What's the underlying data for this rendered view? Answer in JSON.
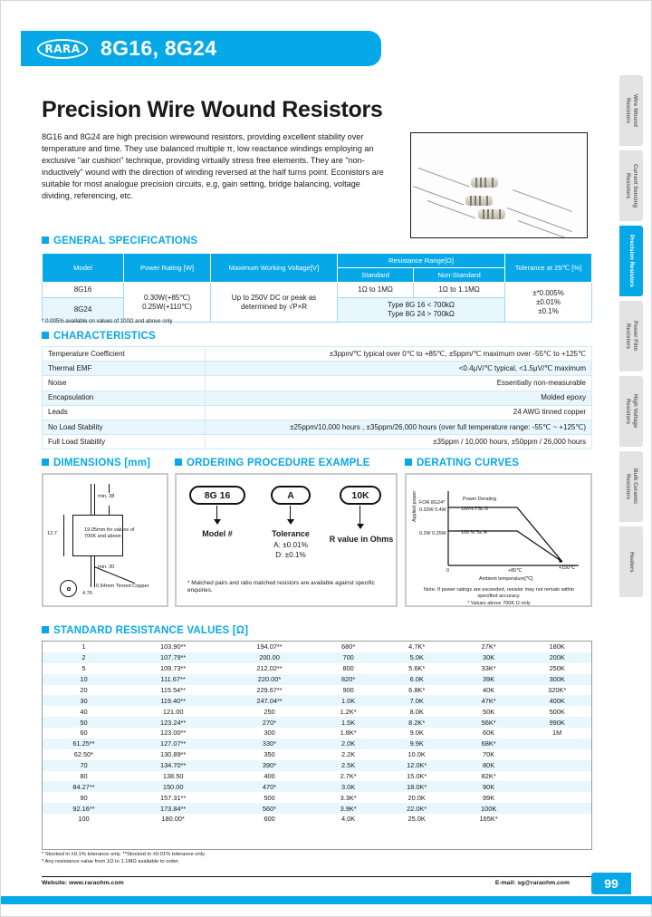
{
  "brand": {
    "logo_text": "RARA",
    "model_title": "8G16, 8G24"
  },
  "hero": {
    "title": "Precision Wire Wound Resistors",
    "body": "8G16 and 8G24 are high precision wirewound resistors, providing excellent stability over temperature and time. They use balanced multiple π, low reactance windings employing an exclusive \"air cushion\" technique, providing virtually stress free elements. They are \"non-inductively\" wound with the direction of winding reversed at the half turns point. Econistors are suitable for most analogue precision circuits, e.g, gain setting, bridge balancing, voltage dividing, referencing, etc."
  },
  "side_tabs": [
    {
      "label": "Wire Wound Resistors",
      "active": false
    },
    {
      "label": "Current Sensing Resistors",
      "active": false
    },
    {
      "label": "Precision Resistors",
      "active": true
    },
    {
      "label": "Power Film Resistors",
      "active": false
    },
    {
      "label": "High Voltage Resistors",
      "active": false
    },
    {
      "label": "Bulk Ceramic Resistors",
      "active": false
    },
    {
      "label": "Heaters",
      "active": false
    }
  ],
  "general_specifications": {
    "heading": "GENERAL SPECIFICATIONS",
    "headers": {
      "model": "Model",
      "power_rating": "Power Rating [W]",
      "max_voltage": "Maximum Working Voltage[V]",
      "resistance_range": "Resistance Range[Ω]",
      "standard": "Standard",
      "non_standard": "Non-Standard",
      "tolerance": "Tolerance at 25℃ [%]"
    },
    "rows": [
      {
        "model": "8G16",
        "standard": "1Ω to 1MΩ",
        "non_standard": "1Ω to 1.1MΩ"
      },
      {
        "model": "8G24",
        "merged": "Type 8G 16 < 700kΩ\nType 8G 24 > 700kΩ"
      }
    ],
    "power_rating": "0.30W(+85℃)\n0.25W(+110℃)",
    "max_voltage": "Up to 250V DC or peak as determined by √P×R",
    "tolerance": "±*0.005%\n±0.01%\n±0.1%",
    "footnote": "* 0.005% available on values of 100Ω and above only"
  },
  "characteristics": {
    "heading": "CHARACTERISTICS",
    "rows": [
      {
        "key": "Temperature Coefficient",
        "value": "±3ppm/℃ typical over 0℃ to +85℃, ±5ppm/℃ maximum over -55℃ to +125℃"
      },
      {
        "key": "Thermal EMF",
        "value": "<0.4μV/℃ typical, <1.5μV/℃ maximum"
      },
      {
        "key": "Noise",
        "value": "Essentially non-measurable"
      },
      {
        "key": "Encapsulation",
        "value": "Molded epoxy"
      },
      {
        "key": "Leads",
        "value": "24 AWG tinned copper"
      },
      {
        "key": "No Load Stability",
        "value": "±25ppm/10,000 hours , ±35ppm/26,000 hours (over full temperature range: -55℃ ~ +125℃)"
      },
      {
        "key": "Full Load Stability",
        "value": "±35ppm / 10,000 hours, ±50ppm / 26,000 hours"
      }
    ]
  },
  "dimensions": {
    "heading": "DIMENSIONS [mm]",
    "labels": {
      "top_lead": "min. 38",
      "body_height": "12.7",
      "body_note": "19.05mm for values of 700K and above",
      "bottom_lead": "min. 30",
      "wire": "0.64mm Tinned Copper",
      "diameter": "4.76"
    }
  },
  "ordering": {
    "heading": "ORDERING PROCEDURE EXAMPLE",
    "parts": [
      {
        "code": "8G 16",
        "label": "Model #",
        "sub": ""
      },
      {
        "code": "A",
        "label": "Tolerance",
        "sub": "A: ±0.01%\nD: ±0.1%"
      },
      {
        "code": "10K",
        "label": "R value in Ohms",
        "sub": ""
      }
    ],
    "note": "* Matched pairs and ratio matched resistors are available against specific enquiries."
  },
  "derating": {
    "heading": "DERATING CURVES",
    "chart_data": {
      "type": "line",
      "title": "Power Derating",
      "xlabel": "Ambient temperature[℃]",
      "ylabel": "Applied power",
      "xlim": [
        0,
        150
      ],
      "ylim": [
        0,
        0.45
      ],
      "grid": false,
      "x_ticks": [
        "0",
        "+85℃",
        "+150℃"
      ],
      "y_ticks": [
        "0.2W 0.25W",
        "0.33W 0.4W"
      ],
      "annotations": [
        "FOR 8G24*",
        "100% TSL D",
        "100 % Ta. A"
      ],
      "series": [
        {
          "name": "8G24 (0.33W / 0.4W)",
          "x": [
            0,
            85,
            150
          ],
          "y": [
            0.4,
            0.4,
            0
          ]
        },
        {
          "name": "8G16 (0.2W / 0.25W)",
          "x": [
            0,
            85,
            150
          ],
          "y": [
            0.25,
            0.25,
            0
          ]
        }
      ]
    },
    "notes": "Note: If power ratings are exceeded, resistor may not remain within specified accuracy.\n* Values above 700K Ω only"
  },
  "standard_resistance": {
    "heading": "STANDARD RESISTANCE VALUES [Ω]",
    "columns": [
      [
        "1",
        "2",
        "5",
        "10",
        "20",
        "30",
        "40",
        "50",
        "60",
        "61.25**",
        "62.50*",
        "70",
        "80",
        "84.27**",
        "90",
        "92.16**",
        "100"
      ],
      [
        "103.90**",
        "107.79**",
        "109.73**",
        "111.67**",
        "115.54**",
        "119.40**",
        "121.00",
        "123.24**",
        "123.00**",
        "127.07**",
        "130.89**",
        "134.70**",
        "138.50",
        "150.00",
        "157.31**",
        "173.84**",
        "180.00*"
      ],
      [
        "194.07**",
        "200.00",
        "212.02**",
        "220.00*",
        "229.67**",
        "247.04**",
        "250",
        "270*",
        "300",
        "330*",
        "350",
        "390*",
        "400",
        "470*",
        "500",
        "560*",
        "600"
      ],
      [
        "680*",
        "700",
        "800",
        "820*",
        "900",
        "1.0K",
        "1.2K*",
        "1.5K",
        "1.8K*",
        "2.0K",
        "2.2K",
        "2.5K",
        "2.7K*",
        "3.0K",
        "3.3K*",
        "3.9K*",
        "4.0K"
      ],
      [
        "4.7K*",
        "5.0K",
        "5.6K*",
        "6.0K",
        "6.8K*",
        "7.0K",
        "8.0K",
        "8.2K*",
        "9.0K",
        "9.9K",
        "10.0K",
        "12.0K*",
        "15.0K*",
        "18.0K*",
        "20.0K",
        "22.0K*",
        "25.0K"
      ],
      [
        "27K*",
        "30K",
        "33K*",
        "39K",
        "40K",
        "47K*",
        "50K",
        "56K*",
        "60K",
        "68K*",
        "70K",
        "80K",
        "82K*",
        "90K",
        "99K",
        "100K",
        "165K*"
      ],
      [
        "180K",
        "200K",
        "250K",
        "300K",
        "320K*",
        "400K",
        "500K",
        "990K",
        "1M",
        "",
        "",
        "",
        "",
        "",
        "",
        "",
        ""
      ]
    ],
    "footnotes": "* Stocked in ±0.1% tolerance only. **Stocked in ±0.01% tolerance only.\n* Any resistance value from 1Ω to 1.1MΩ available to order."
  },
  "footer": {
    "website": "Website: www.raraohm.com",
    "email": "E-mail: sg@raraohm.com",
    "page": "99"
  }
}
